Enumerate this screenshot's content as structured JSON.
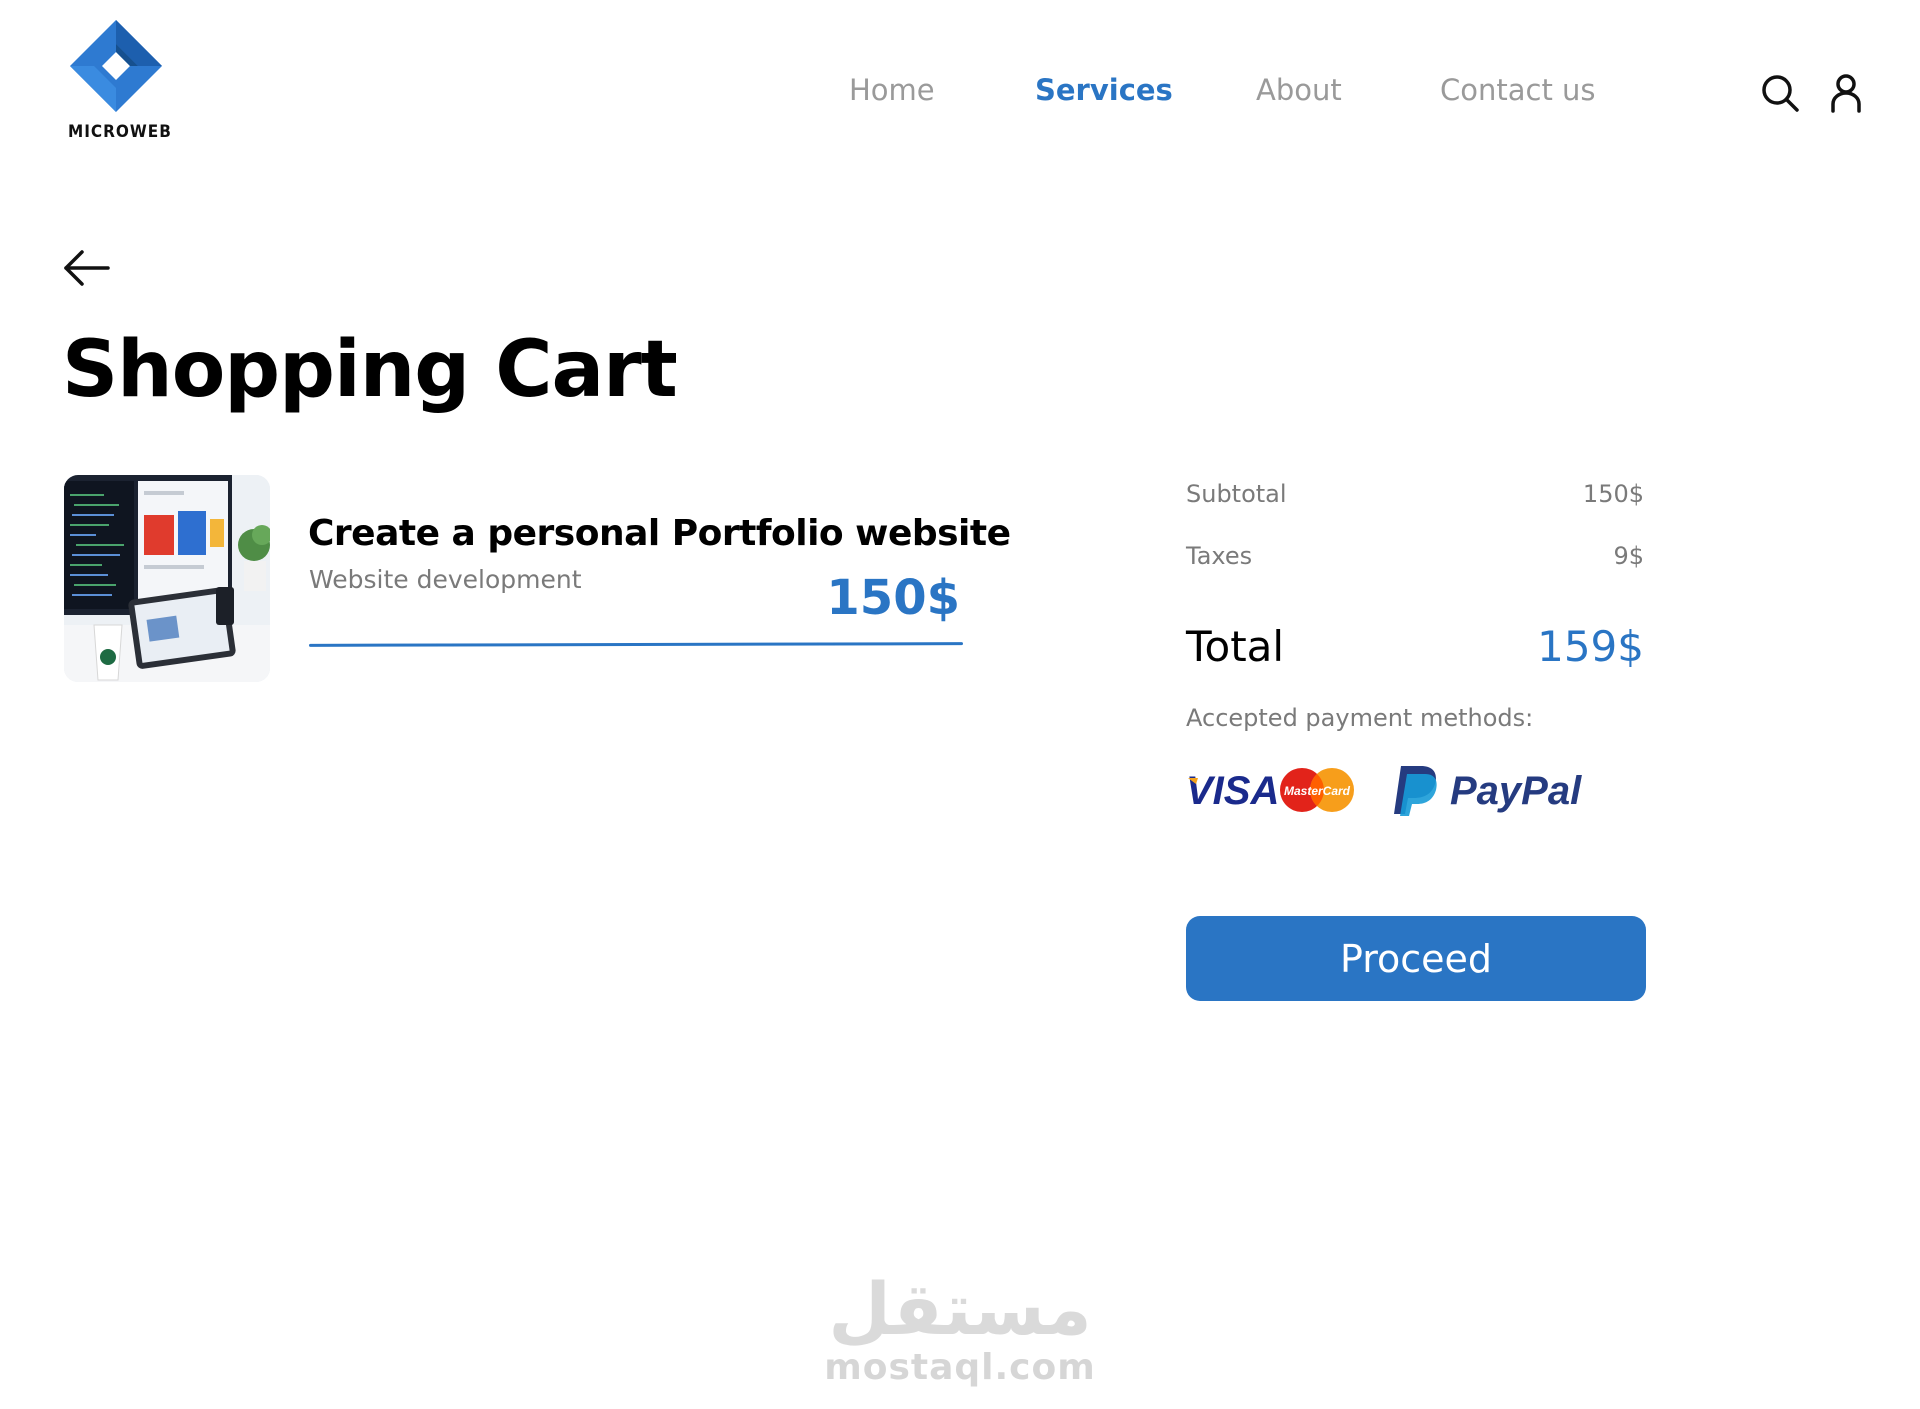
{
  "brand": {
    "name": "MICROWEB",
    "color": "#2a75c4"
  },
  "nav": {
    "items": [
      {
        "label": "Home",
        "active": false
      },
      {
        "label": "Services",
        "active": true
      },
      {
        "label": "About",
        "active": false
      },
      {
        "label": "Contact us",
        "active": false
      }
    ],
    "icons": [
      "search-icon",
      "user-icon"
    ]
  },
  "page": {
    "back_icon": "arrow-left-icon",
    "title": "Shopping Cart"
  },
  "cart": {
    "items": [
      {
        "title": "Create a personal Portfolio website",
        "subtitle": "Website development",
        "price": "150$"
      }
    ]
  },
  "summary": {
    "subtotal_label": "Subtotal",
    "subtotal_value": "150$",
    "taxes_label": "Taxes",
    "taxes_value": "9$",
    "total_label": "Total",
    "total_value": "159$",
    "payment_label": "Accepted  payment methods:",
    "payment_methods": [
      "VISA",
      "MasterCard",
      "PayPal"
    ],
    "proceed_label": "Proceed"
  },
  "watermark": {
    "arabic": "مستقل",
    "latin": "mostaql.com"
  }
}
